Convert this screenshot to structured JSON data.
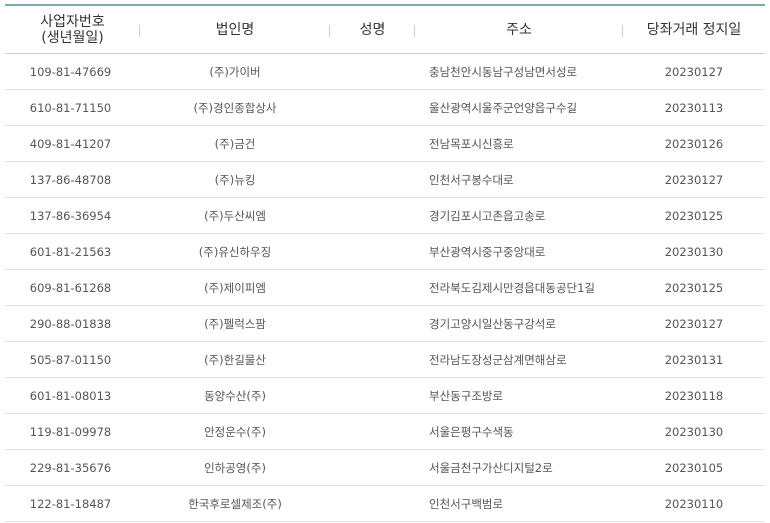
{
  "headers": {
    "bizno_line1": "사업자번호",
    "bizno_line2": "(생년월일)",
    "corp": "법인명",
    "name": "성명",
    "addr": "주소",
    "date": "당좌거래 정지일"
  },
  "rows": [
    {
      "bizno": "109-81-47669",
      "corp": "(주)가이버",
      "name": "",
      "addr": "충남천안시동남구성남면서성로",
      "date": "20230127"
    },
    {
      "bizno": "610-81-71150",
      "corp": "(주)경인종합상사",
      "name": "",
      "addr": "울산광역시울주군언양읍구수길",
      "date": "20230113"
    },
    {
      "bizno": "409-81-41207",
      "corp": "(주)금건",
      "name": "",
      "addr": "전남목포시신흥로",
      "date": "20230126"
    },
    {
      "bizno": "137-86-48708",
      "corp": "(주)뉴킹",
      "name": "",
      "addr": "인천서구봉수대로",
      "date": "20230127"
    },
    {
      "bizno": "137-86-36954",
      "corp": "(주)두산씨엠",
      "name": "",
      "addr": "경기김포시고촌읍고송로",
      "date": "20230125"
    },
    {
      "bizno": "601-81-21563",
      "corp": "(주)유신하우징",
      "name": "",
      "addr": "부산광역시중구중앙대로",
      "date": "20230130"
    },
    {
      "bizno": "609-81-61268",
      "corp": "(주)제이피엠",
      "name": "",
      "addr": "전라북도김제시만경읍대동공단1길",
      "date": "20230125"
    },
    {
      "bizno": "290-88-01838",
      "corp": "(주)펠럭스팜",
      "name": "",
      "addr": "경기고양시일산동구강석로",
      "date": "20230127"
    },
    {
      "bizno": "505-87-01150",
      "corp": "(주)한길물산",
      "name": "",
      "addr": "전라남도장성군삼계면해삼로",
      "date": "20230131"
    },
    {
      "bizno": "601-81-08013",
      "corp": "동양수산(주)",
      "name": "",
      "addr": "부산동구조방로",
      "date": "20230118"
    },
    {
      "bizno": "119-81-09978",
      "corp": "안정운수(주)",
      "name": "",
      "addr": "서울은평구수색동",
      "date": "20230130"
    },
    {
      "bizno": "229-81-35676",
      "corp": "인하공영(주)",
      "name": "",
      "addr": "서울금천구가산디지털2로",
      "date": "20230105"
    },
    {
      "bizno": "122-81-18487",
      "corp": "한국후로셀제조(주)",
      "name": "",
      "addr": "인천서구백범로",
      "date": "20230110"
    }
  ]
}
